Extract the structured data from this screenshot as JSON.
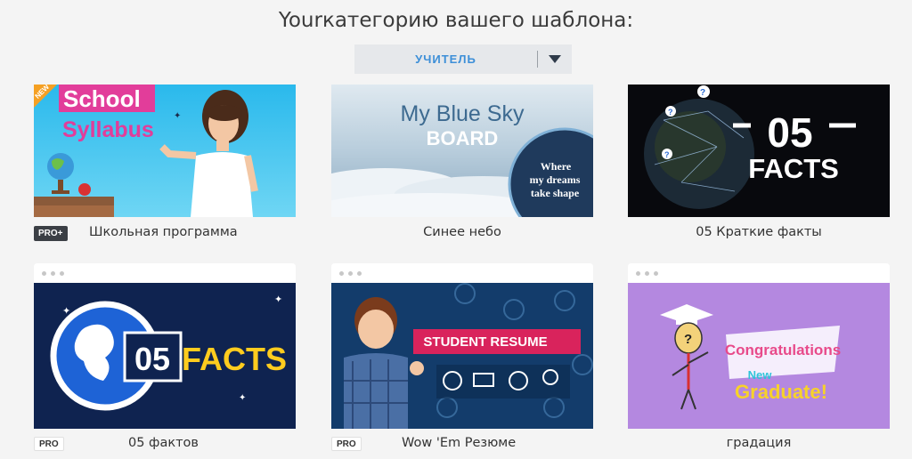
{
  "header": {
    "title": "Yourкатегорию вашего шаблона:"
  },
  "dropdown": {
    "selected": "УЧИТЕЛЬ",
    "icon": "chevron-down-icon"
  },
  "templates": [
    {
      "title": "Школьная программа",
      "badge": "PRO+",
      "thumb_text": [
        "School",
        "Syllabus"
      ],
      "corner_tag": "NEW"
    },
    {
      "title": "Синее небо",
      "thumb_text": [
        "My Blue Sky",
        "BOARD",
        "Where",
        "my dreams",
        "take shape"
      ]
    },
    {
      "title": "05 Краткие факты",
      "thumb_text": [
        "05",
        "FACTS"
      ]
    },
    {
      "title": "05 фактов",
      "badge": "PRO",
      "thumb_text": [
        "05",
        "FACTS"
      ]
    },
    {
      "title": "Wow 'Em Резюме",
      "badge": "PRO",
      "thumb_text": [
        "STUDENT RESUME"
      ]
    },
    {
      "title": "градация",
      "thumb_text": [
        "Congratulations",
        "New",
        "Graduate!"
      ]
    }
  ],
  "colors": {
    "accent": "#3d8fd8",
    "badge_bg": "#3b3f45",
    "page_bg": "#f4f4f4"
  }
}
